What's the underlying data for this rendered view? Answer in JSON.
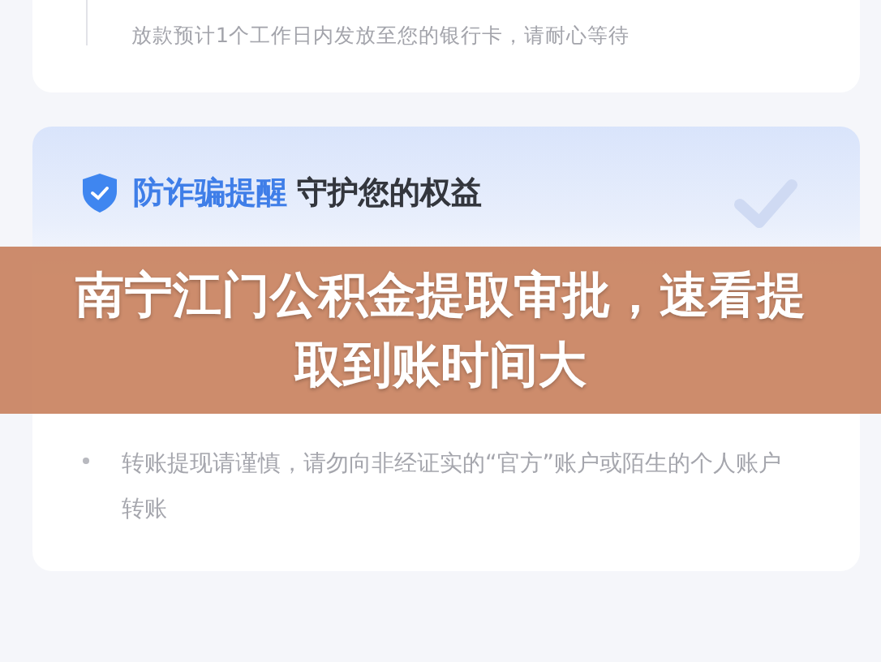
{
  "timeline_step": {
    "description": "放款预计1个工作日内发放至您的银行卡，请耐心等待"
  },
  "notice": {
    "title_highlight": "防诈骗提醒",
    "title": "守护您的权益",
    "tips": [
      {
        "text": "转账提现请谨慎，请勿向非经证实的“官方”账户或陌生的个人账户转账"
      }
    ]
  },
  "banner": {
    "headline": "南宁江门公积金提取审批，速看提取到账时间大"
  }
}
